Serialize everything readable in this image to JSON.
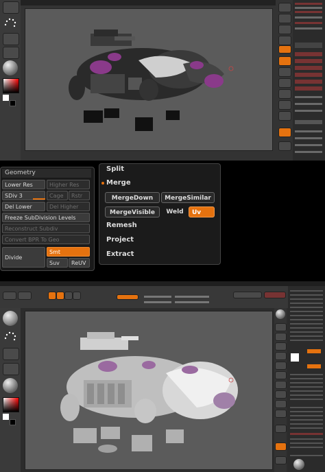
{
  "geometry_palette": {
    "title": "Geometry",
    "lower_res": "Lower Res",
    "higher_res": "Higher Res",
    "sdiv_label": "SDiv 3",
    "cage": "Cage",
    "rstr": "Rstr",
    "del_lower": "Del Lower",
    "del_higher": "Del Higher",
    "freeze": "Freeze SubDivision Levels",
    "reconstruct": "Reconstruct Subdiv",
    "convert": "Convert BPR To Geo",
    "divide": "Divide",
    "smt": "Smt",
    "suv": "Suv",
    "reuv": "ReUV"
  },
  "subtool_menu": {
    "split": "Split",
    "merge": "Merge",
    "merge_down": "MergeDown",
    "merge_similar": "MergeSimilar",
    "merge_visible": "MergeVisible",
    "weld": "Weld",
    "uv": "Uv",
    "remesh": "Remesh",
    "project": "Project",
    "extract": "Extract"
  },
  "colors": {
    "accent_orange": "#e5720f",
    "panel_bg": "#1b1b1b",
    "viewport_bg": "#5b5b5b",
    "mesh_purple": "#8a3a8a"
  },
  "icons": [
    "sphere-brush-icon",
    "stroke-dots-icon",
    "color-picker-icon",
    "material-sphere-icon",
    "texture-icon"
  ]
}
